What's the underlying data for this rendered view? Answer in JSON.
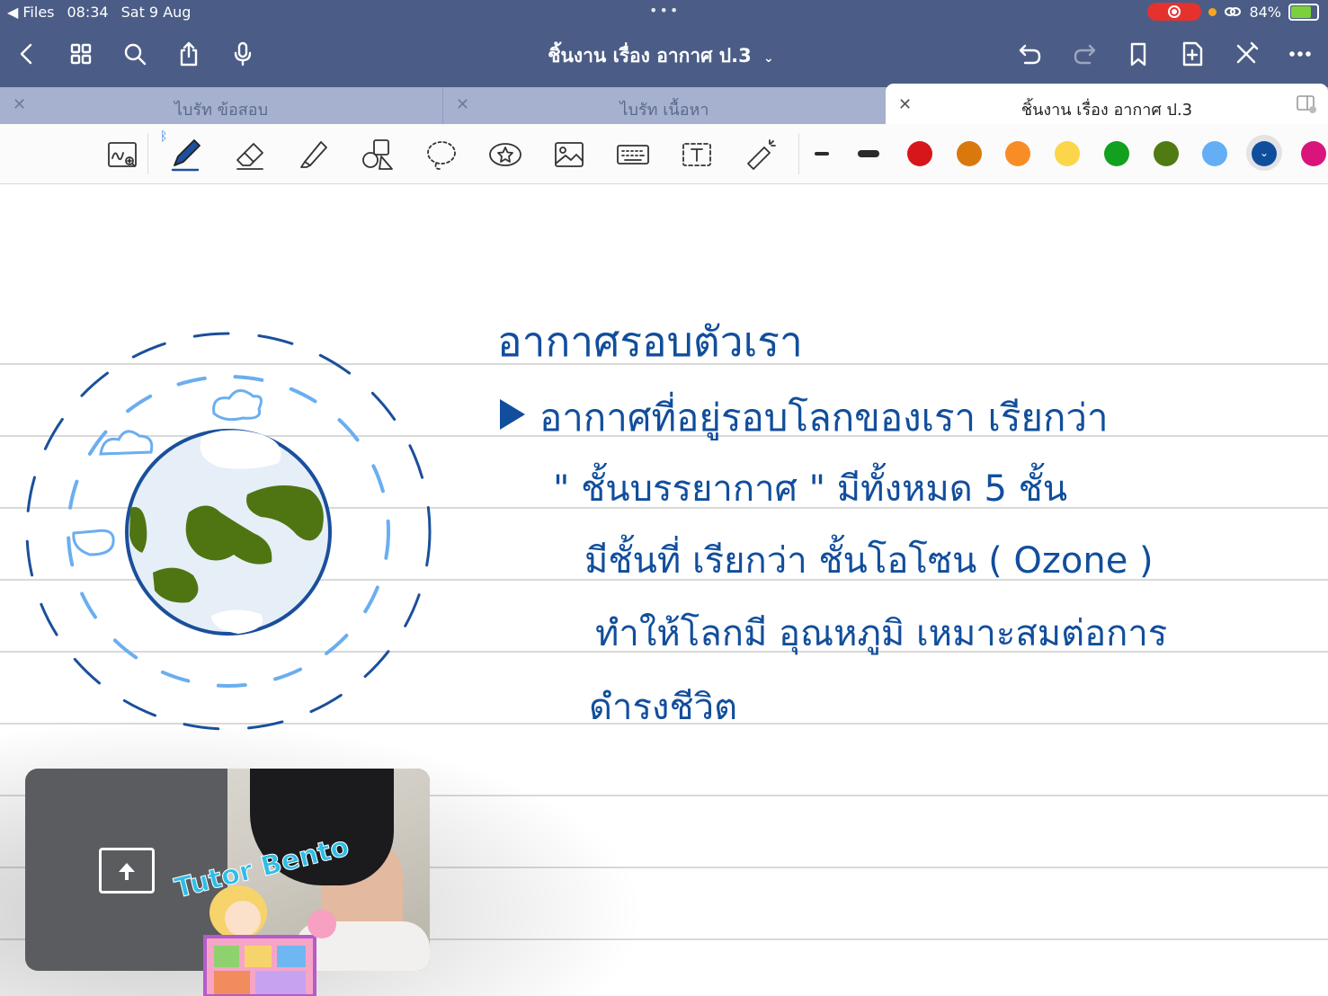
{
  "status_bar": {
    "back_app": "Files",
    "time": "08:34",
    "date": "Sat 9 Aug",
    "battery": "84%",
    "battery_level": 0.84
  },
  "nav": {
    "doc_title": "ชิ้นงาน เรื่อง อากาศ ป.3"
  },
  "tabs": [
    {
      "label": "ไบรัท ข้อสอบ",
      "active": false
    },
    {
      "label": "ไบรัท เนื้อหา",
      "active": false
    },
    {
      "label": "ชิ้นงาน เรื่อง อากาศ ป.3",
      "active": true
    }
  ],
  "toolbar": {
    "colors": [
      "#d7161b",
      "#d9780d",
      "#f98d25",
      "#fbd64a",
      "#12a01f",
      "#4f7b12",
      "#63aef5",
      "#0f4e9d",
      "#d9157c"
    ],
    "selected_color": "#0f4e9d"
  },
  "notes": {
    "title": "อากาศรอบตัวเรา",
    "line1": "อากาศที่อยู่รอบโลกของเรา เรียกว่า",
    "line2": "\" ชั้นบรรยากาศ \" มีทั้งหมด 5 ชั้น",
    "line3": "มีชั้นที่ เรียกว่า ชั้นโอโซน ( Ozone )",
    "line4": "ทำให้โลกมี อุณหภูมิ เหมาะสมต่อการ",
    "line5": "ดำรงชีวิต"
  },
  "overlay": {
    "logo_text": "Tutor Bento"
  }
}
